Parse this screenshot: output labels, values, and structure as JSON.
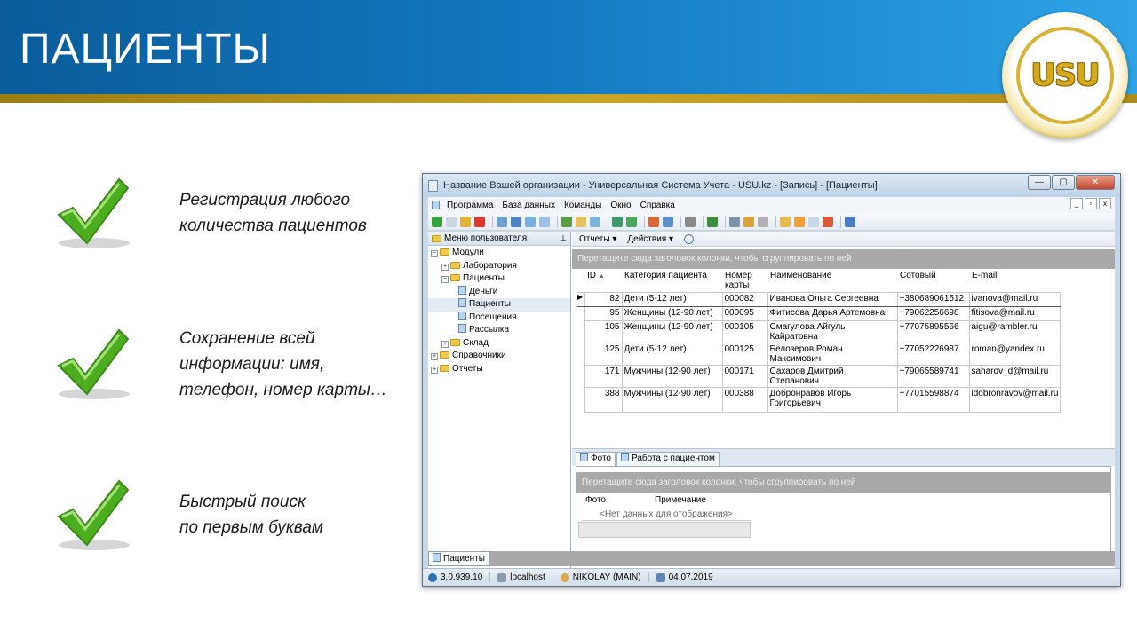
{
  "slide": {
    "title": "ПАЦИЕНТЫ",
    "logo_text": "USU",
    "bullets": [
      {
        "lines": [
          "Регистрация любого",
          "количества пациентов"
        ]
      },
      {
        "lines": [
          "Сохранение всей",
          "информации: имя,",
          "телефон, номер карты…"
        ]
      },
      {
        "lines": [
          "Быстрый поиск",
          "по первым буквам"
        ]
      }
    ]
  },
  "window": {
    "title": "Название Вашей организации - Универсальная Система Учета - USU.kz - [Запись] - [Пациенты]",
    "menu": [
      "Программа",
      "База данных",
      "Команды",
      "Окно",
      "Справка"
    ],
    "left_panel": {
      "header": "Меню пользователя",
      "tree": [
        {
          "label": "Модули",
          "level": 0,
          "kind": "folder",
          "exp": "−"
        },
        {
          "label": "Лаборатория",
          "level": 1,
          "kind": "folder",
          "exp": "+"
        },
        {
          "label": "Пациенты",
          "level": 1,
          "kind": "folder",
          "exp": "−"
        },
        {
          "label": "Деньги",
          "level": 2,
          "kind": "doc"
        },
        {
          "label": "Пациенты",
          "level": 2,
          "kind": "doc",
          "selected": true
        },
        {
          "label": "Посещения",
          "level": 2,
          "kind": "doc"
        },
        {
          "label": "Рассылка",
          "level": 2,
          "kind": "doc"
        },
        {
          "label": "Склад",
          "level": 1,
          "kind": "folder",
          "exp": "+"
        },
        {
          "label": "Справочники",
          "level": 0,
          "kind": "folder",
          "exp": "+"
        },
        {
          "label": "Отчеты",
          "level": 0,
          "kind": "folder",
          "exp": "+"
        }
      ]
    },
    "right_toolbar": {
      "reports": "Отчеты",
      "actions": "Действия"
    },
    "group_hint": "Перетащите сюда заголовок колонки, чтобы сгруппировать по ней",
    "grid": {
      "columns": [
        "ID",
        "Категория пациента",
        "Номер карты",
        "Наименование",
        "Сотовый",
        "E-mail"
      ],
      "rows": [
        [
          "82",
          "Дети (5-12 лет)",
          "000082",
          "Иванова Ольга Сергеевна",
          "+380689061512",
          "ivanova@mail.ru"
        ],
        [
          "95",
          "Женщины (12-90 лет)",
          "000095",
          "Фитисова Дарья Артемовна",
          "+79062256698",
          "fitisova@mail.ru"
        ],
        [
          "105",
          "Женщины (12-90 лет)",
          "000105",
          "Смагулова Айгуль Кайратовна",
          "+77075895566",
          "aigu@rambler.ru"
        ],
        [
          "125",
          "Дети (5-12 лет)",
          "000125",
          "Белозеров Роман Максимович",
          "+77052226987",
          "roman@yandex.ru"
        ],
        [
          "171",
          "Мужчины (12-90 лет)",
          "000171",
          "Сахаров Дмитрий Степанович",
          "+79065589741",
          "saharov_d@mail.ru"
        ],
        [
          "388",
          "Мужчины (12-90 лет)",
          "000388",
          "Добронравов Игорь Григорьевич",
          "+77015598874",
          "idobronravov@mail.ru"
        ]
      ],
      "count": "6"
    },
    "detail_tabs": [
      "Фото",
      "Работа с пациентом"
    ],
    "detail_group_hint": "Перетащите сюда заголовок колонки, чтобы сгруппировать по ней",
    "detail_columns": [
      "Фото",
      "Примечание"
    ],
    "no_data": "<Нет данных для отображения>",
    "bottom_tab": "Пациенты",
    "status": {
      "version": "3.0.939.10",
      "host": "localhost",
      "user": "NIKOLAY (MAIN)",
      "date": "04.07.2019"
    }
  }
}
